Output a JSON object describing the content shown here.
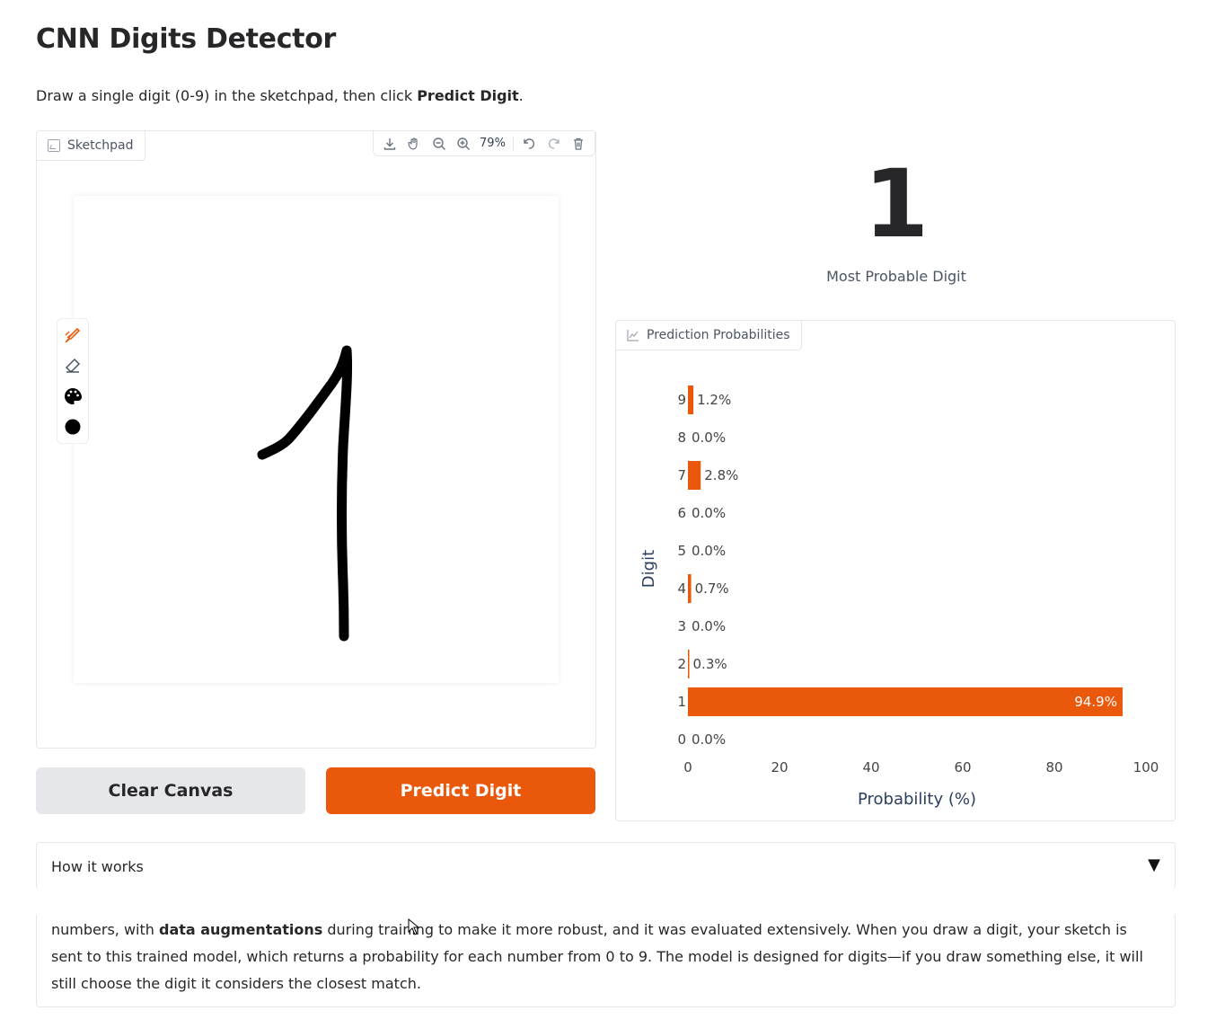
{
  "header": {
    "title": "CNN Digits Detector",
    "desc_prefix": "Draw a single digit (0-9) in the sketchpad, then click ",
    "desc_bold": "Predict Digit",
    "desc_suffix": "."
  },
  "sketchpad": {
    "label": "Sketchpad",
    "zoom": "79%",
    "toolbar_icons": [
      "download-icon",
      "pan-icon",
      "zoom-out-icon",
      "zoom-in-icon",
      "undo-icon",
      "redo-icon",
      "trash-icon"
    ],
    "tools": [
      "brush-icon",
      "eraser-icon",
      "palette-icon",
      "brush-size-icon"
    ],
    "accent": "#ea580c"
  },
  "buttons": {
    "clear": "Clear Canvas",
    "predict": "Predict Digit"
  },
  "result": {
    "digit": "1",
    "caption": "Most Probable Digit"
  },
  "chart_panel": {
    "label": "Prediction Probabilities"
  },
  "chart_data": {
    "type": "bar",
    "orientation": "horizontal",
    "categories": [
      "0",
      "1",
      "2",
      "3",
      "4",
      "5",
      "6",
      "7",
      "8",
      "9"
    ],
    "values": [
      0.0,
      94.9,
      0.3,
      0.0,
      0.7,
      0.0,
      0.0,
      2.8,
      0.0,
      1.2
    ],
    "value_labels": [
      "0.0%",
      "94.9%",
      "0.3%",
      "0.0%",
      "0.7%",
      "0.0%",
      "0.0%",
      "2.8%",
      "0.0%",
      "1.2%"
    ],
    "xlabel": "Probability (%)",
    "ylabel": "Digit",
    "xlim": [
      0,
      100
    ],
    "xticks": [
      "0",
      "20",
      "40",
      "60",
      "80",
      "100"
    ],
    "grid": false,
    "bar_color": "#ea580c"
  },
  "accordion": {
    "label": "How it works",
    "text_1": "numbers, with ",
    "text_bold": "data augmentations",
    "text_2": " during training to make it more robust, and it was evaluated extensively. When you draw a digit, your sketch is sent to this trained model, which returns a probability for each number from 0 to 9. The model is designed for digits—if you draw something else, it will still choose the digit it considers the closest match."
  }
}
